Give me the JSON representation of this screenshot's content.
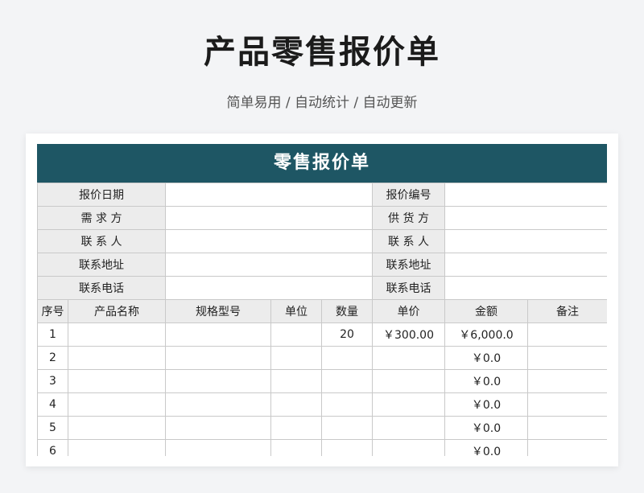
{
  "page": {
    "title": "产品零售报价单",
    "subtitle": "简单易用 / 自动统计 / 自动更新"
  },
  "sheet": {
    "title": "零售报价单",
    "info_rows": [
      {
        "left_label": "报价日期",
        "left_value": "",
        "right_label": "报价编号",
        "right_value": ""
      },
      {
        "left_label": "需 求 方",
        "left_value": "",
        "right_label": "供 货 方",
        "right_value": ""
      },
      {
        "left_label": "联 系 人",
        "left_value": "",
        "right_label": "联 系 人",
        "right_value": ""
      },
      {
        "left_label": "联系地址",
        "left_value": "",
        "right_label": "联系地址",
        "right_value": ""
      },
      {
        "left_label": "联系电话",
        "left_value": "",
        "right_label": "联系电话",
        "right_value": ""
      }
    ],
    "columns": [
      "序号",
      "产品名称",
      "规格型号",
      "单位",
      "数量",
      "单价",
      "金额",
      "备注"
    ],
    "rows": [
      {
        "no": "1",
        "name": "",
        "spec": "",
        "unit": "",
        "qty": "20",
        "price": "￥300.00",
        "amount": "￥6,000.0",
        "note": ""
      },
      {
        "no": "2",
        "name": "",
        "spec": "",
        "unit": "",
        "qty": "",
        "price": "",
        "amount": "￥0.0",
        "note": ""
      },
      {
        "no": "3",
        "name": "",
        "spec": "",
        "unit": "",
        "qty": "",
        "price": "",
        "amount": "￥0.0",
        "note": ""
      },
      {
        "no": "4",
        "name": "",
        "spec": "",
        "unit": "",
        "qty": "",
        "price": "",
        "amount": "￥0.0",
        "note": ""
      },
      {
        "no": "5",
        "name": "",
        "spec": "",
        "unit": "",
        "qty": "",
        "price": "",
        "amount": "￥0.0",
        "note": ""
      },
      {
        "no": "6",
        "name": "",
        "spec": "",
        "unit": "",
        "qty": "",
        "price": "",
        "amount": "￥0.0",
        "note": ""
      }
    ]
  }
}
